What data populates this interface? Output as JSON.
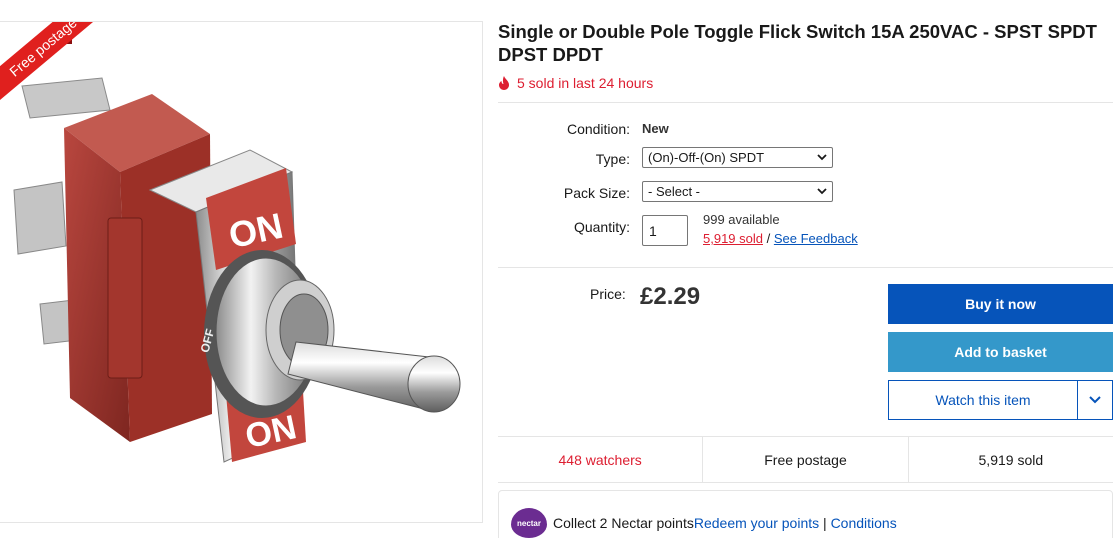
{
  "gallery": {
    "ribbon": "Free postage",
    "on_top": "ON",
    "on_bottom": "ON",
    "off_mark": "OFF"
  },
  "listing": {
    "title": "Single or Double Pole Toggle Flick Switch 15A 250VAC - SPST SPDT DPST DPDT",
    "hot_text": "5 sold in last 24 hours"
  },
  "details": {
    "condition_label": "Condition:",
    "condition_value": "New",
    "type_label": "Type:",
    "type_value": "(On)-Off-(On) SPDT",
    "pack_label": "Pack Size:",
    "pack_value": "- Select -",
    "quantity_label": "Quantity:",
    "quantity_value": "1",
    "available": "999 available",
    "sold_link": "5,919 sold",
    "separator": "/",
    "feedback_link": "See Feedback"
  },
  "pricing": {
    "label": "Price:",
    "value": "£2.29"
  },
  "actions": {
    "buy_now": "Buy it now",
    "add_basket": "Add to basket",
    "watch": "Watch this item"
  },
  "stats": {
    "watchers": "448 watchers",
    "postage": "Free postage",
    "sold": "5,919 sold"
  },
  "nectar": {
    "logo_text": "nectar",
    "collect": "Collect 2 Nectar points",
    "redeem": "Redeem your points",
    "divider": "|",
    "conditions": "Conditions"
  },
  "colors": {
    "accent_blue": "#0654ba",
    "basket_blue": "#3498ca",
    "alert_red": "#dd1e31",
    "nectar_purple": "#6b2c91"
  }
}
